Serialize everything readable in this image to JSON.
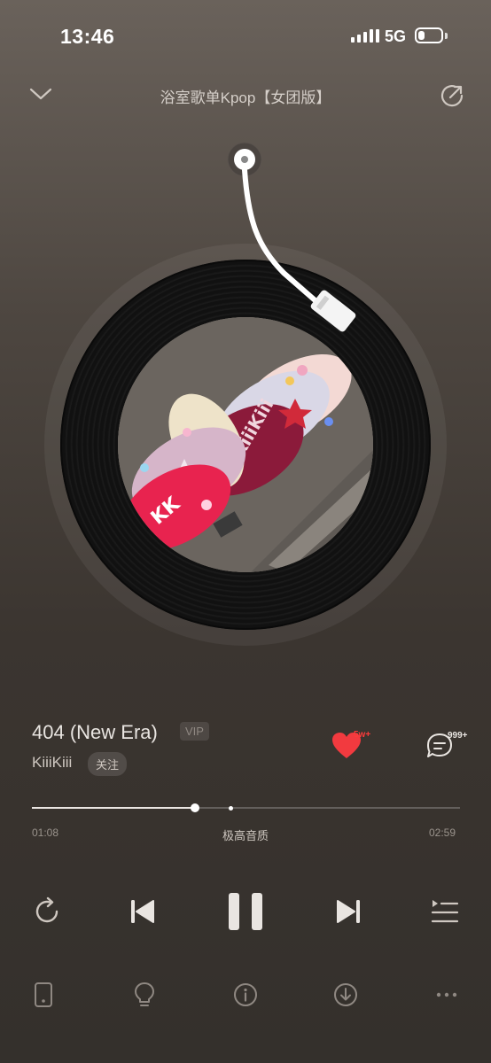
{
  "status_bar": {
    "time": "13:46",
    "network": "5G"
  },
  "header": {
    "title": "浴室歌单Kpop【女团版】",
    "icons": [
      "chevron-down-icon",
      "share-icon"
    ]
  },
  "player": {
    "song_title": "404 (New Era)",
    "vip_badge": "VIP",
    "artist": "KiiiKiii",
    "follow_label": "关注",
    "like_count": "5w+",
    "comment_count": "999+",
    "current_time": "01:08",
    "duration": "02:59",
    "quality_label": "极高音质",
    "progress": 0.38,
    "buffered": 0.465,
    "is_playing": true
  },
  "controls": [
    "repeat-icon",
    "previous-icon",
    "pause-icon",
    "next-icon",
    "playlist-icon"
  ],
  "bottom_bar": [
    "device-icon",
    "lightbulb-icon",
    "info-icon",
    "download-icon",
    "more-icon"
  ],
  "colors": {
    "like": "#ff3b3b",
    "text_primary": "#e9e5e1",
    "text_secondary": "#9a938c"
  }
}
